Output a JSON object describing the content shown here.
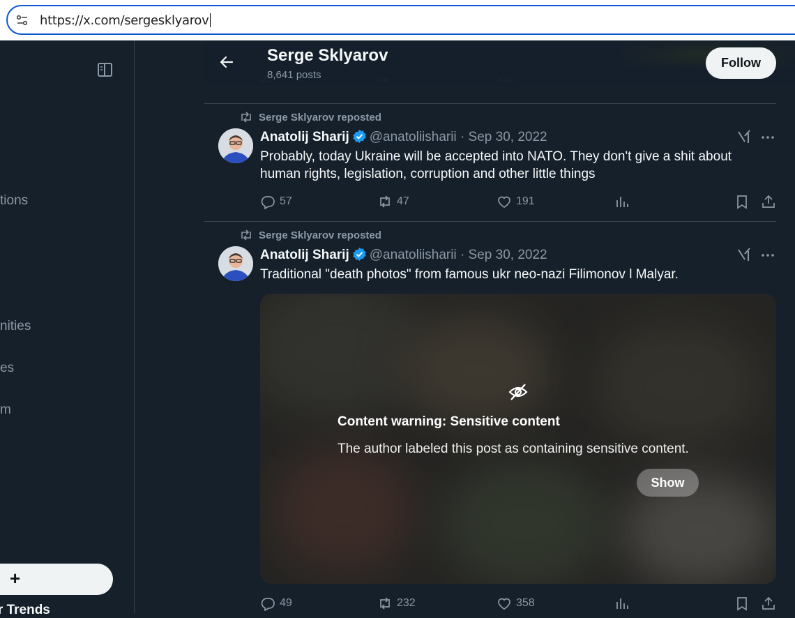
{
  "browser": {
    "url": "https://x.com/sergesklyarov"
  },
  "left_nav": {
    "items": [
      {
        "label": "tions"
      },
      {
        "label": "nities"
      },
      {
        "label": "es"
      },
      {
        "label": "m"
      }
    ],
    "post_button_label": "+",
    "trends_label": "ter Trends"
  },
  "header": {
    "name": "Serge Sklyarov",
    "posts": "8,641 posts",
    "follow_label": "Follow"
  },
  "partial_prev_actions": {
    "reply": "21",
    "repost": "29",
    "like": "225"
  },
  "tweets": [
    {
      "reposted_by": "Serge Sklyarov reposted",
      "author": "Anatolij Sharij",
      "handle": "@anatoliisharii",
      "dot": "·",
      "date": "Sep 30, 2022",
      "text": "Probably, today Ukraine will be accepted into NATO.  They don't give a shit about human rights, legislation, corruption and other little things",
      "replies": "57",
      "reposts": "47",
      "likes": "191"
    },
    {
      "reposted_by": "Serge Sklyarov reposted",
      "author": "Anatolij Sharij",
      "handle": "@anatoliisharii",
      "dot": "·",
      "date": "Sep 30, 2022",
      "text": "Traditional \"death photos\" from famous ukr neo-nazi Filimonov l Malyar.",
      "replies": "49",
      "reposts": "232",
      "likes": "358",
      "content_warning": {
        "title": "Content warning: Sensitive content",
        "description": "The author labeled this post as containing sensitive content.",
        "show_label": "Show"
      }
    }
  ],
  "colors": {
    "background": "#15202b",
    "border": "#38444d",
    "muted": "#8b98a5",
    "verified": "#1d9bf0"
  }
}
